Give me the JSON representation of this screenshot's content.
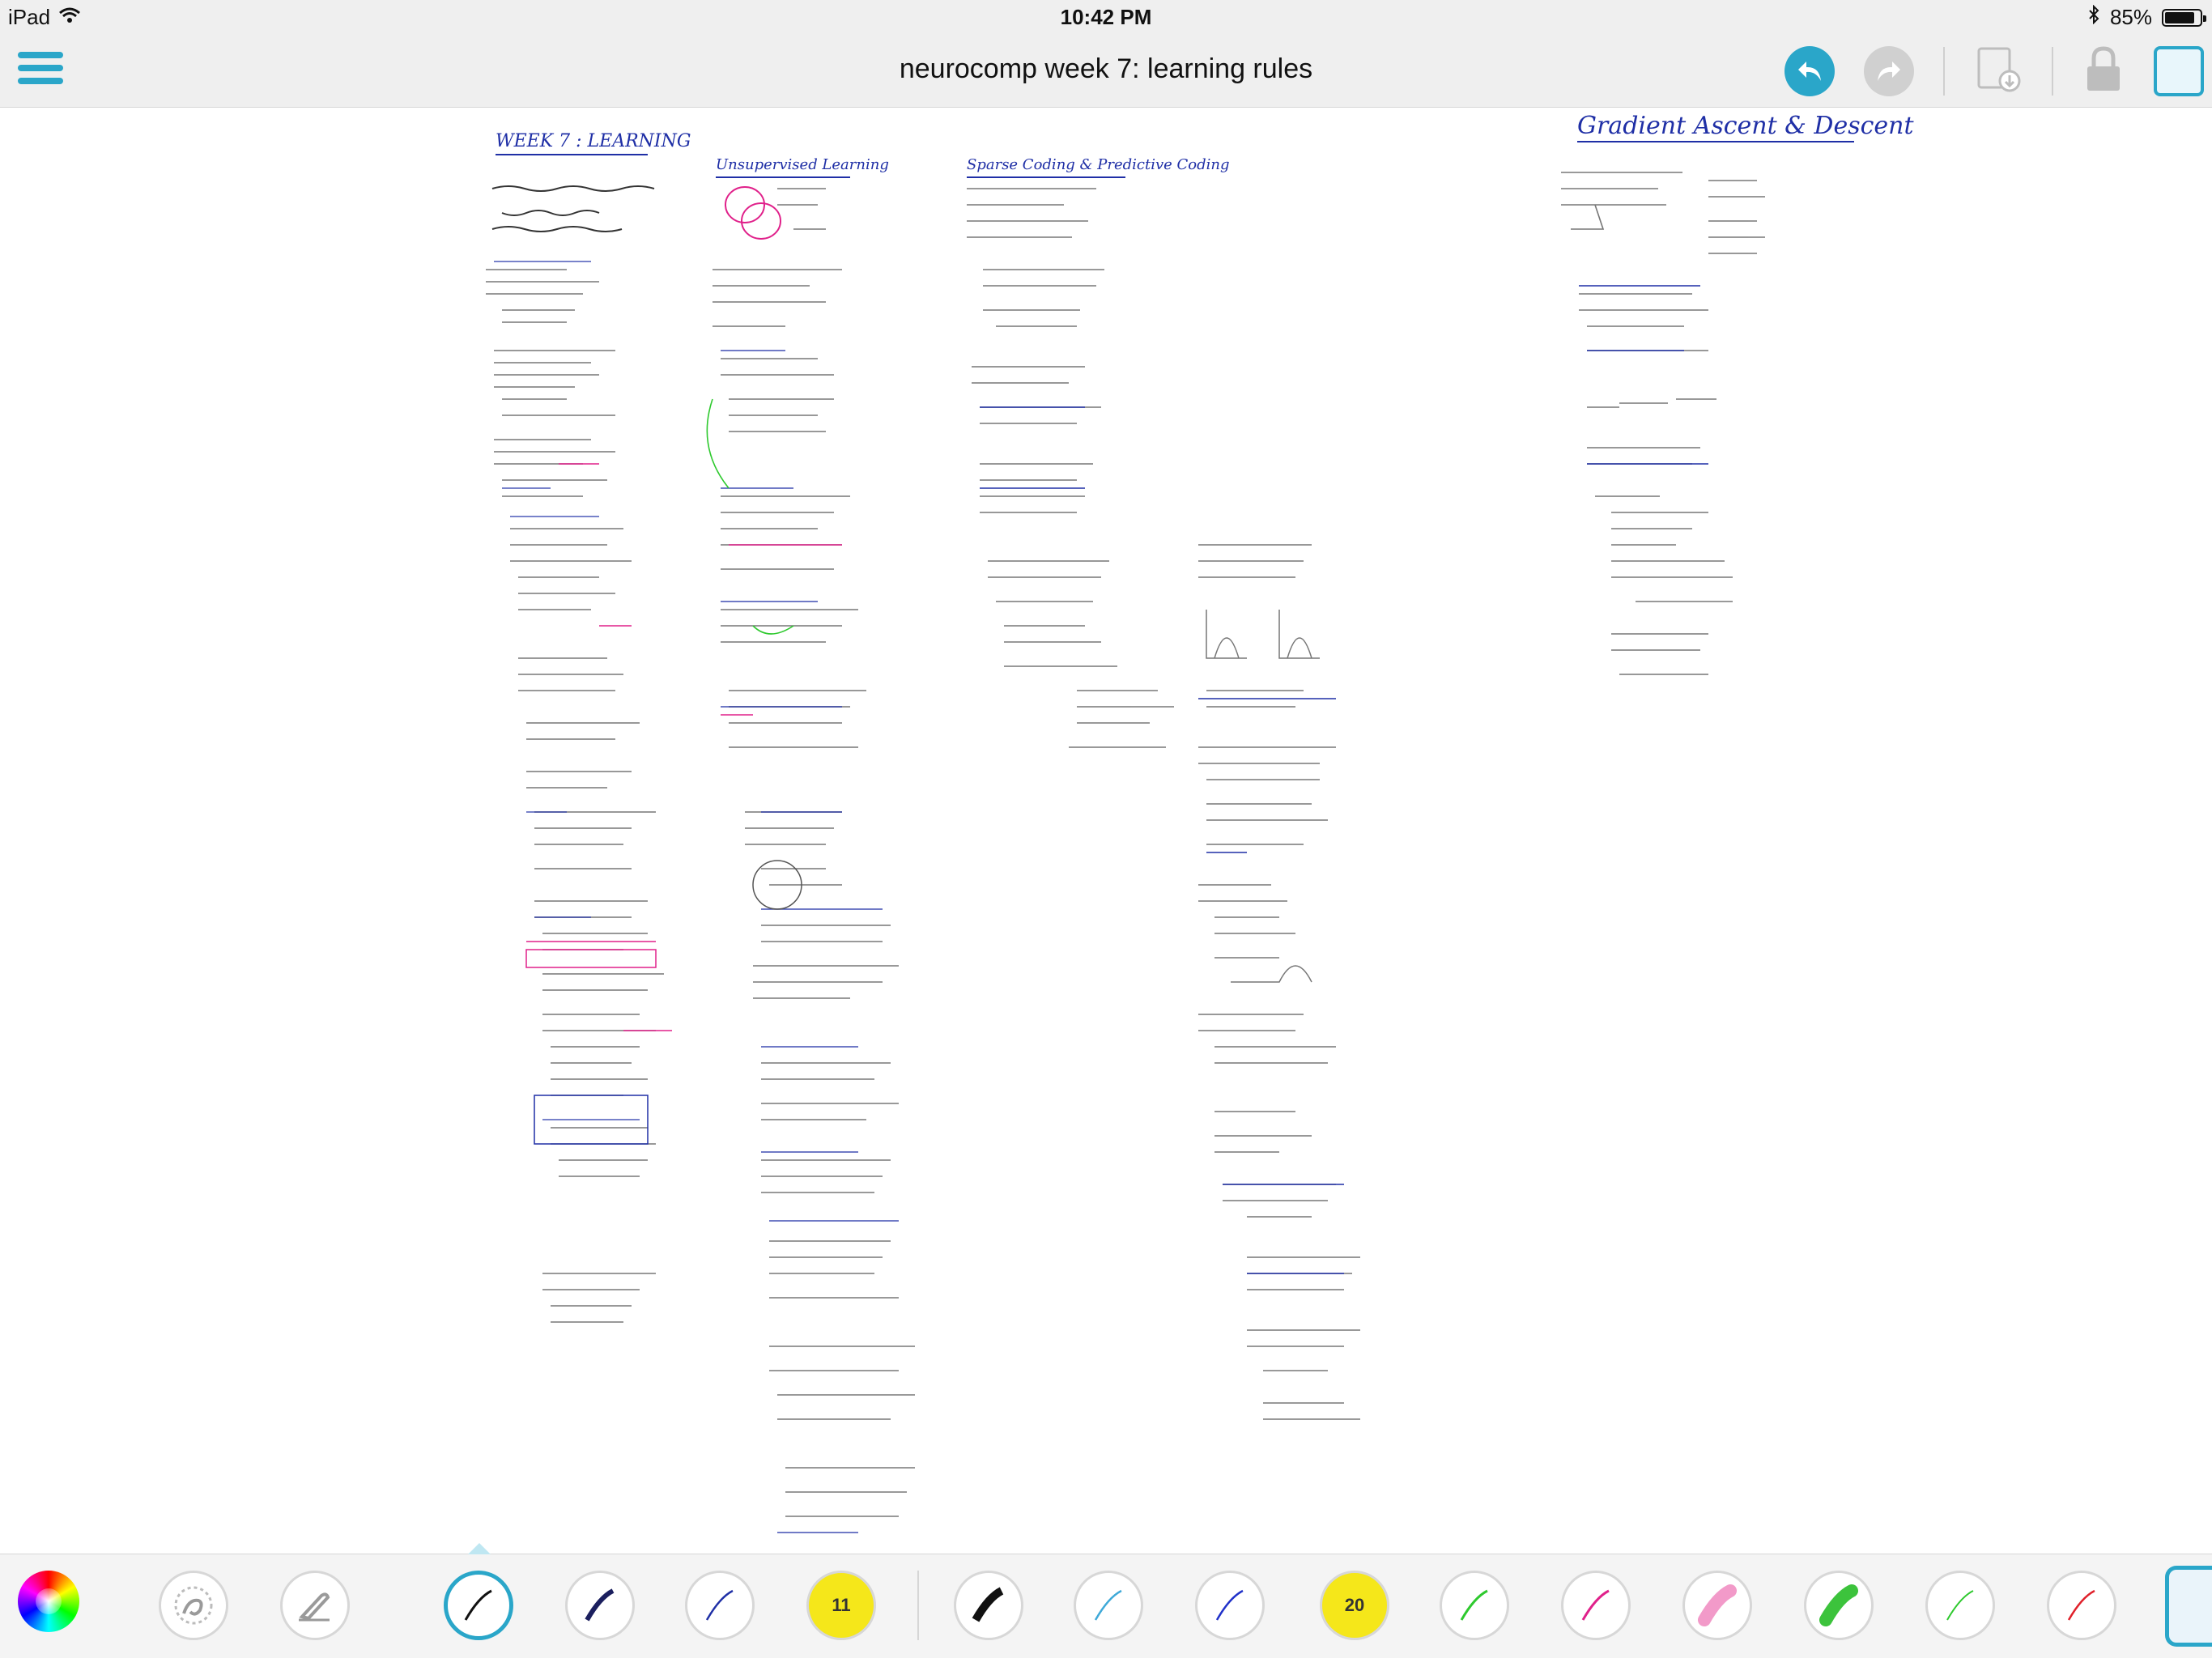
{
  "status_bar": {
    "device": "iPad",
    "time": "10:42 PM",
    "battery_percent": "85%",
    "battery_level": 0.85
  },
  "nav": {
    "title": "neurocomp week 7: learning rules",
    "accent_color": "#2aa6c9"
  },
  "canvas": {
    "section_titles": [
      "WEEK 7 : LEARNING",
      "Unsupervised Learning",
      "Sparse Coding & Predictive Coding",
      "Gradient Ascent & Descent"
    ]
  },
  "toolbar": {
    "pen_size_badges": [
      "11",
      "20"
    ],
    "tools": [
      {
        "name": "color-wheel"
      },
      {
        "name": "lasso-tool"
      },
      {
        "name": "eraser-tool"
      },
      {
        "name": "pen-black-thin",
        "color": "#111111",
        "selected": true
      },
      {
        "name": "pen-navy",
        "color": "#1b1f5e"
      },
      {
        "name": "pen-blue-thin",
        "color": "#1f2fa6"
      },
      {
        "name": "highlighter-yellow-11",
        "color": "#f5e71a"
      },
      {
        "name": "pen-black-thick",
        "color": "#111111"
      },
      {
        "name": "pen-lightblue",
        "color": "#3ea9d8"
      },
      {
        "name": "pen-blue",
        "color": "#2031c9"
      },
      {
        "name": "highlighter-yellow-20",
        "color": "#f5e71a"
      },
      {
        "name": "pen-green",
        "color": "#2ec92e"
      },
      {
        "name": "pen-magenta",
        "color": "#e0208a"
      },
      {
        "name": "highlighter-pink",
        "color": "#f29ac9"
      },
      {
        "name": "highlighter-green",
        "color": "#3cc33c"
      },
      {
        "name": "pen-green-thin",
        "color": "#2ec92e"
      },
      {
        "name": "pen-red",
        "color": "#e0202a"
      }
    ]
  }
}
